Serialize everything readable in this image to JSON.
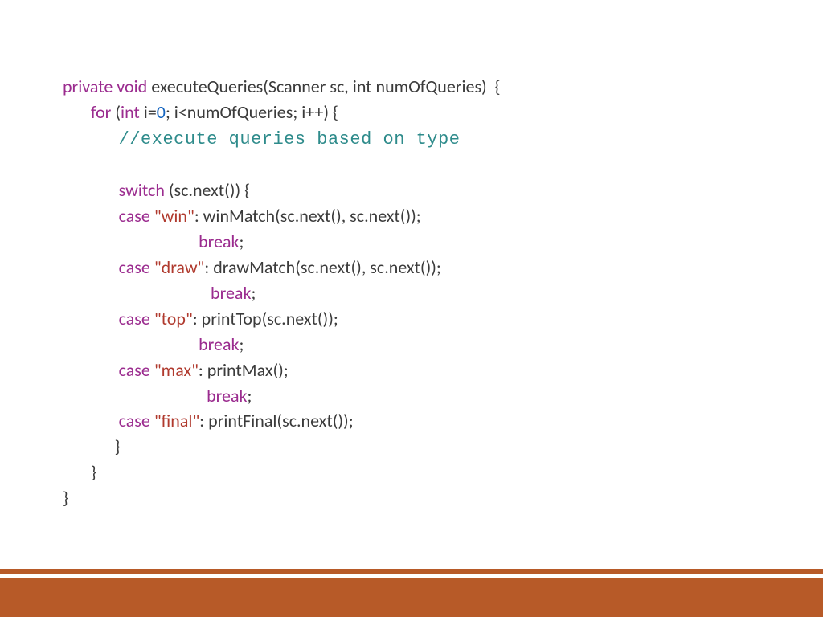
{
  "colors": {
    "keyword": "#9b2c8f",
    "string": "#b03a2e",
    "number": "#1565c0",
    "comment": "#2e8b8b",
    "text": "#3b3b3b",
    "accent": "#b75a28"
  },
  "code": {
    "l1_private": "private",
    "l1_void": "void",
    "l1_rest": " executeQueries(Scanner sc, int numOfQueries)  {",
    "l2_for": "for",
    "l2_paren1": " (",
    "l2_int": "int",
    "l2_ieq": " i=",
    "l2_zero": "0",
    "l2_rest": "; i<numOfQueries; i++) {",
    "l3_comment": "//execute queries based on type",
    "l5_switch": "switch",
    "l5_rest": " (sc.next()) {",
    "l6_case": "case",
    "l6_str": " \"win\"",
    "l6_rest": ": winMatch(sc.next(), sc.next());",
    "l7_break": "break",
    "l7_semi": ";",
    "l8_case": "case",
    "l8_str": " \"draw\"",
    "l8_rest": ": drawMatch(sc.next(), sc.next());",
    "l9_break": "break",
    "l9_semi": ";",
    "l10_case": "case",
    "l10_str": " \"top\"",
    "l10_rest": ": printTop(sc.next());",
    "l11_break": "break",
    "l11_semi": ";",
    "l12_case": "case",
    "l12_str": " \"max\"",
    "l12_rest": ": printMax();",
    "l13_break": "break",
    "l13_semi": ";",
    "l14_case": "case",
    "l14_str": " \"final\"",
    "l14_rest": ": printFinal(sc.next());",
    "l15_brace": "}",
    "l16_brace": "}",
    "l17_brace": "}"
  }
}
